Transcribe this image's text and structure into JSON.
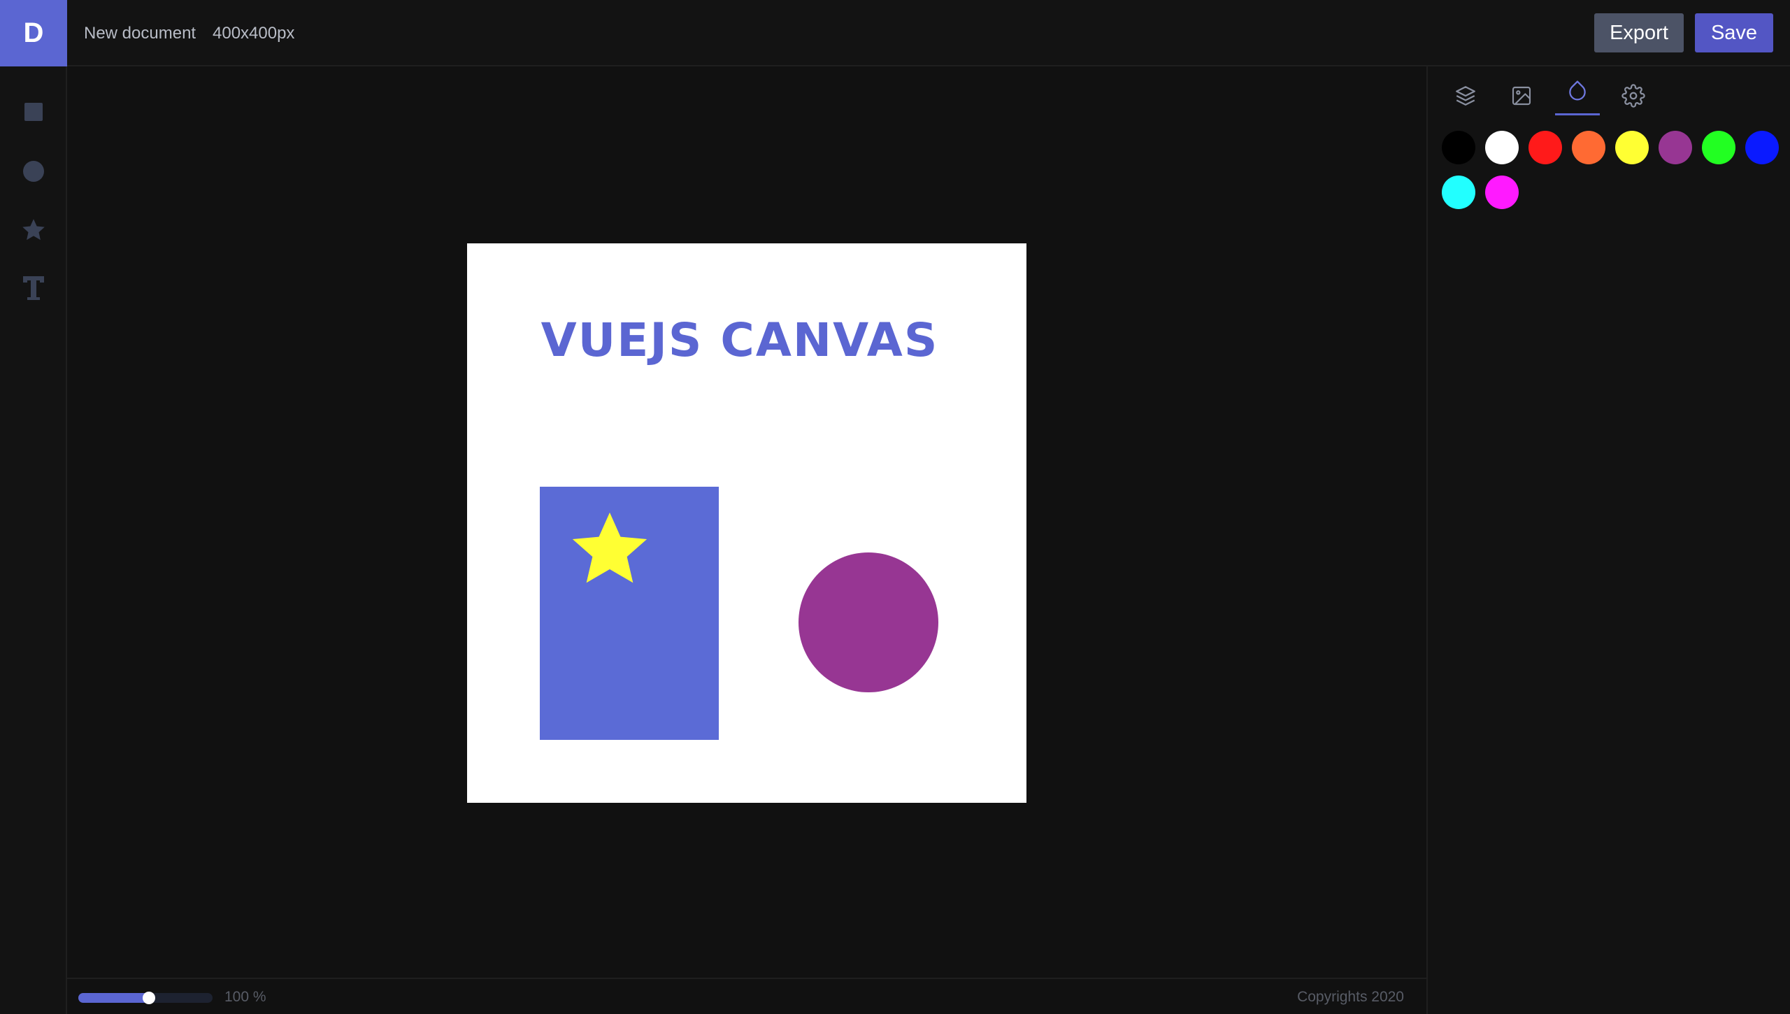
{
  "header": {
    "logo": "D",
    "document_title": "New document",
    "document_size": "400x400px",
    "export_label": "Export",
    "save_label": "Save"
  },
  "left_toolbar": {
    "tools": [
      {
        "name": "rectangle-tool",
        "icon": "square-icon"
      },
      {
        "name": "circle-tool",
        "icon": "circle-icon"
      },
      {
        "name": "star-tool",
        "icon": "star-icon"
      },
      {
        "name": "text-tool",
        "icon": "text-icon"
      }
    ],
    "tool_color": "#3a4256"
  },
  "canvas": {
    "text": "VUEJS CANVAS",
    "text_color": "#5b66d2",
    "rect_color": "#5b6bd6",
    "star_color": "#ffff33",
    "circle_color": "#973693",
    "background": "#ffffff"
  },
  "right_panel": {
    "tabs": [
      {
        "name": "layers",
        "icon": "layers-icon"
      },
      {
        "name": "image",
        "icon": "image-icon"
      },
      {
        "name": "color",
        "icon": "droplet-icon",
        "active": true
      },
      {
        "name": "settings",
        "icon": "gear-icon"
      }
    ],
    "swatches": [
      "#000000",
      "#ffffff",
      "#ff1a1a",
      "#ff6a33",
      "#ffff33",
      "#973693",
      "#22ff22",
      "#0a1aff",
      "#22ffff",
      "#ff1aff"
    ]
  },
  "status": {
    "zoom_value": 50,
    "zoom_label": "100 %",
    "copyright": "Copyrights 2020"
  },
  "colors": {
    "accent": "#5b66d2",
    "export_button": "#4c5366",
    "save_button": "#5356c4"
  }
}
